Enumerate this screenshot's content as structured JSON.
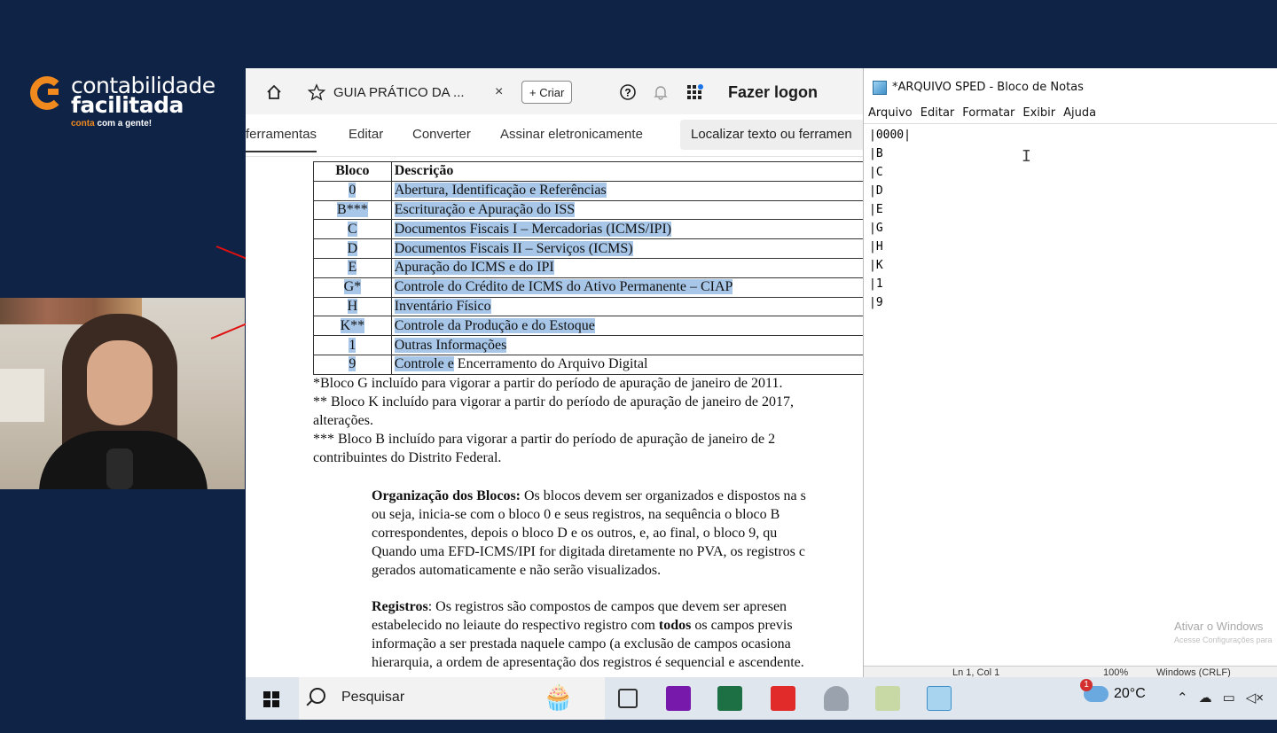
{
  "brand": {
    "line1": "contabilidade",
    "line2": "facilitada",
    "tagline_accent": "conta",
    "tagline_rest": " com a gente!"
  },
  "browser": {
    "tab_title": "GUIA PRÁTICO DA ...",
    "tab_close": "×",
    "new_button": "+ Criar",
    "help": "?",
    "login": "Fazer logon"
  },
  "pdf_toolbar": {
    "tools": [
      "ferramentas",
      "Editar",
      "Converter",
      "Assinar eletronicamente"
    ],
    "find": "Localizar texto ou ferramen"
  },
  "pdf": {
    "table_headers": [
      "Bloco",
      "Descrição"
    ],
    "rows": [
      {
        "bloco": "0",
        "descricao": "Abertura, Identificação e Referências"
      },
      {
        "bloco": "B***",
        "descricao": "Escrituração e Apuração do ISS"
      },
      {
        "bloco": "C",
        "descricao": "Documentos Fiscais I – Mercadorias (ICMS/IPI)"
      },
      {
        "bloco": "D",
        "descricao": "Documentos Fiscais II – Serviços (ICMS)"
      },
      {
        "bloco": "E",
        "descricao": "Apuração do ICMS e do IPI"
      },
      {
        "bloco": "G*",
        "descricao": "Controle do Crédito de ICMS do Ativo Permanente – CIAP"
      },
      {
        "bloco": "H",
        "descricao": "Inventário Físico"
      },
      {
        "bloco": "K**",
        "descricao": "Controle da Produção e do Estoque"
      },
      {
        "bloco": "1",
        "descricao": "Outras Informações"
      },
      {
        "bloco": "9",
        "descricao_hl": "Controle e",
        "descricao_rest": " Encerramento do Arquivo Digital"
      }
    ],
    "footnotes": [
      "*Bloco G incluído para vigorar a partir do período de apuração de janeiro de 2011.",
      "** Bloco K incluído para vigorar a partir do período de apuração de janeiro de 2017,",
      "alterações.",
      "*** Bloco B incluído para vigorar a partir do período de apuração de janeiro de 2",
      "contribuintes do Distrito Federal."
    ],
    "org_title": "Organização dos Blocos:",
    "org_lines": [
      " Os blocos devem ser organizados e dispostos na s",
      "ou seja, inicia-se com o bloco 0 e seus registros, na sequência o bloco B",
      "correspondentes, depois o bloco D e os outros, e, ao final, o bloco 9, qu",
      "Quando uma EFD-ICMS/IPI for digitada diretamente no PVA, os registros c",
      "gerados automaticamente e não serão visualizados."
    ],
    "reg_title": "Registros",
    "reg_line1": ": Os registros são compostos de campos que devem ser apresen",
    "reg_line2_a": "estabelecido no leiaute do respectivo registro com ",
    "reg_line2_b": "todos",
    "reg_line2_c": " os campos previs",
    "reg_lines": [
      "informação a ser prestada naquele campo (a exclusão de campos ocasiona",
      "hierarquia, a ordem de apresentação dos registros é sequencial e ascendente."
    ]
  },
  "notepad": {
    "title": "*ARQUIVO SPED - Bloco de Notas",
    "menu": [
      "Arquivo",
      "Editar",
      "Formatar",
      "Exibir",
      "Ajuda"
    ],
    "lines": [
      "|0000|",
      "|B",
      "|C",
      "|D",
      "|E",
      "|G",
      "|H",
      "|K",
      "|1",
      "|9"
    ],
    "watermark_title": "Ativar o Windows",
    "watermark_sub": "Acesse Configurações para",
    "status": [
      "Ln 1, Col 1",
      "100%",
      "Windows (CRLF)"
    ]
  },
  "taskbar": {
    "search": "Pesquisar",
    "weather": "20°C",
    "weather_badge": "1"
  }
}
